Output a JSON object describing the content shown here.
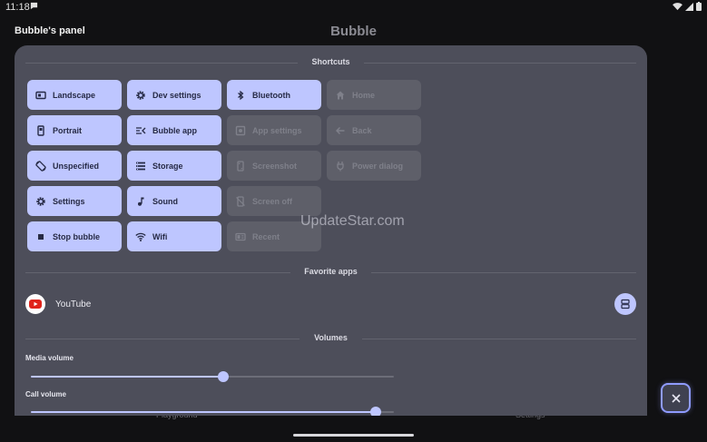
{
  "status": {
    "time": "11:18"
  },
  "header": {
    "panel_title": "Bubble's panel",
    "app_title": "Bubble"
  },
  "background_nav": {
    "left": "Playground",
    "right": "Settings"
  },
  "sections": {
    "shortcuts": "Shortcuts",
    "favorites": "Favorite apps",
    "volumes": "Volumes"
  },
  "tiles": [
    {
      "label": "Landscape",
      "icon": "landscape-icon",
      "enabled": true
    },
    {
      "label": "Dev settings",
      "icon": "gear-icon",
      "enabled": true
    },
    {
      "label": "Bluetooth",
      "icon": "bluetooth-icon",
      "enabled": true
    },
    {
      "label": "Home",
      "icon": "home-icon",
      "enabled": false
    },
    {
      "label": "Portrait",
      "icon": "portrait-icon",
      "enabled": true
    },
    {
      "label": "Bubble app",
      "icon": "bubble-app-icon",
      "enabled": true
    },
    {
      "label": "App settings",
      "icon": "app-settings-icon",
      "enabled": false
    },
    {
      "label": "Back",
      "icon": "arrow-left-icon",
      "enabled": false
    },
    {
      "label": "Unspecified",
      "icon": "rotate-icon",
      "enabled": true
    },
    {
      "label": "Storage",
      "icon": "storage-icon",
      "enabled": true
    },
    {
      "label": "Screenshot",
      "icon": "screenshot-icon",
      "enabled": false
    },
    {
      "label": "Power dialog",
      "icon": "power-plug-icon",
      "enabled": false
    },
    {
      "label": "Settings",
      "icon": "gear-icon",
      "enabled": true
    },
    {
      "label": "Sound",
      "icon": "music-note-icon",
      "enabled": true
    },
    {
      "label": "Screen off",
      "icon": "screen-off-icon",
      "enabled": false
    },
    {
      "label": "Stop bubble",
      "icon": "stop-icon",
      "enabled": true
    },
    {
      "label": "Wifi",
      "icon": "wifi-icon",
      "enabled": true
    },
    {
      "label": "Recent",
      "icon": "recent-icon",
      "enabled": false
    }
  ],
  "favorites": [
    {
      "name": "YouTube",
      "icon": "youtube-icon"
    }
  ],
  "volumes": [
    {
      "label": "Media volume",
      "level": 0.53
    },
    {
      "label": "Call volume",
      "level": 0.95
    }
  ],
  "watermark": "UpdateStar.com",
  "colors": {
    "accent": "#bec6ff",
    "panel": "#4d4e5a",
    "tile_disabled": "#5e5f69"
  }
}
